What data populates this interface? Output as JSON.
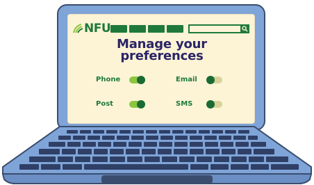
{
  "brand": {
    "logo_text": "NFU"
  },
  "page": {
    "title_line1": "Manage your",
    "title_line2": "preferences"
  },
  "preferences": [
    {
      "label": "Phone",
      "enabled": true
    },
    {
      "label": "Email",
      "enabled": false
    },
    {
      "label": "Post",
      "enabled": true
    },
    {
      "label": "SMS",
      "enabled": false
    }
  ],
  "colors": {
    "brand_green": "#1f7a3a",
    "toggle_on": "#8cc63f",
    "toggle_off": "#d9d39a",
    "title_navy": "#2b2466",
    "screen_bg": "#fdf4d6",
    "laptop_body": "#7fa4d8"
  },
  "icons": {
    "search": "search-icon",
    "logo": "nfu-logo-icon"
  }
}
